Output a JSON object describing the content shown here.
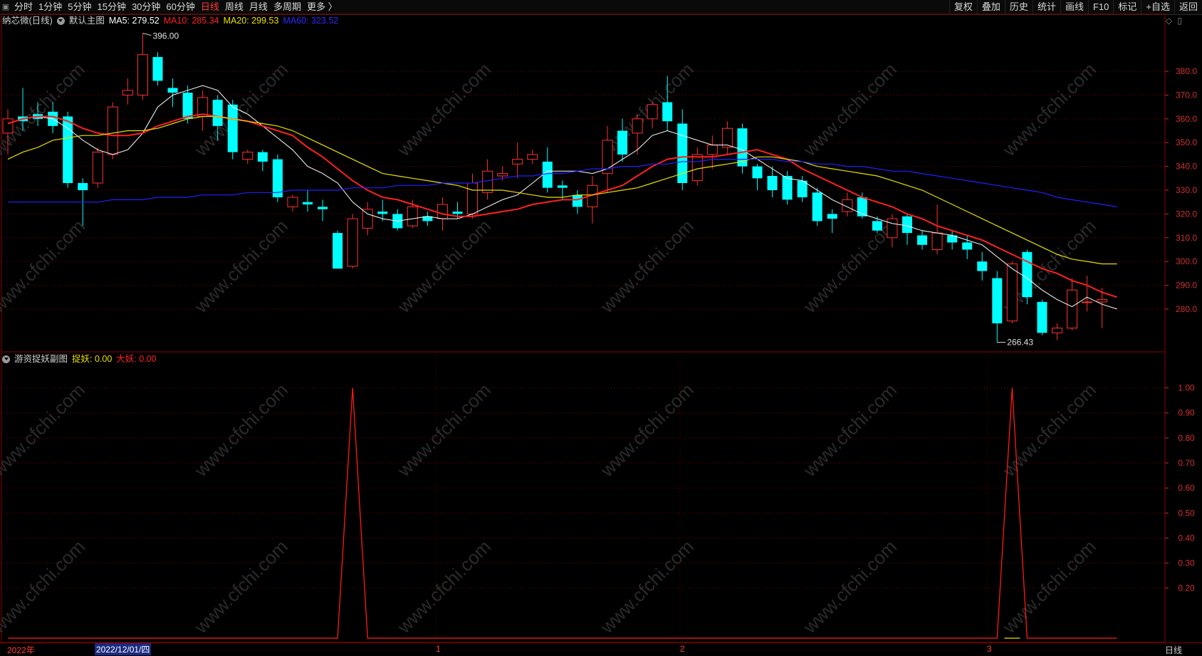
{
  "toolbar": {
    "window_icon": "▣",
    "periods": [
      "分时",
      "1分钟",
      "5分钟",
      "15分钟",
      "30分钟",
      "60分钟",
      "日线",
      "周线",
      "月线",
      "多周期",
      "更多 〉"
    ],
    "active_period": "日线",
    "right_buttons": [
      "复权",
      "叠加",
      "历史",
      "统计",
      "画线",
      "F10",
      "标记",
      "+自选",
      "返回"
    ]
  },
  "main_header": {
    "stock": "纳芯微(日线)",
    "template": "默认主图",
    "ma5": "MA5: 279.52",
    "ma10": "MA10: 285.34",
    "ma20": "MA20: 299.53",
    "ma60": "MA60: 323.52"
  },
  "sub_header": {
    "name": "游资捉妖副图",
    "zhuoyao": "捉妖: 0.00",
    "dayao": "大妖: 0.00"
  },
  "corner": {
    "diamond": "◇",
    "square": "▯"
  },
  "colors": {
    "up": "#ff3030",
    "down": "#00ffff",
    "ma5": "#ffffff",
    "ma10": "#ff2020",
    "ma20": "#e8e000",
    "ma60": "#2020ff",
    "grid": "#7a0000"
  },
  "annotations": {
    "high": "396.00",
    "low": "266.43"
  },
  "price_axis": [
    "380.0",
    "370.0",
    "360.0",
    "350.0",
    "340.0",
    "330.0",
    "320.0",
    "310.0",
    "300.0",
    "290.0",
    "280.0"
  ],
  "sub_axis": [
    "1.00",
    "0.90",
    "0.80",
    "0.70",
    "0.60",
    "0.50",
    "0.40",
    "0.30",
    "0.20"
  ],
  "date_bar": {
    "year_label": "2022年",
    "cursor_date": "2022/12/01/四",
    "months": [
      "1",
      "2",
      "3"
    ],
    "period_label": "日线"
  },
  "watermark": "www.cfchi.com",
  "chart_data": {
    "type": "candlestick",
    "y_range": [
      262,
      398
    ],
    "candles": [
      {
        "o": 354,
        "c": 360,
        "h": 364,
        "l": 345
      },
      {
        "o": 361,
        "c": 359,
        "h": 373,
        "l": 355
      },
      {
        "o": 362,
        "c": 360,
        "h": 367,
        "l": 357
      },
      {
        "o": 363,
        "c": 357,
        "h": 367,
        "l": 354
      },
      {
        "o": 361,
        "c": 333,
        "h": 363,
        "l": 331
      },
      {
        "o": 333,
        "c": 330,
        "h": 335,
        "l": 315
      },
      {
        "o": 333,
        "c": 346,
        "h": 348,
        "l": 331
      },
      {
        "o": 345,
        "c": 365,
        "h": 367,
        "l": 343
      },
      {
        "o": 370,
        "c": 372,
        "h": 377,
        "l": 366
      },
      {
        "o": 370,
        "c": 387,
        "h": 396,
        "l": 368
      },
      {
        "o": 386,
        "c": 376,
        "h": 388,
        "l": 374
      },
      {
        "o": 373,
        "c": 371,
        "h": 377,
        "l": 365
      },
      {
        "o": 371,
        "c": 360,
        "h": 374,
        "l": 358
      },
      {
        "o": 361,
        "c": 369,
        "h": 372,
        "l": 355
      },
      {
        "o": 368,
        "c": 357,
        "h": 370,
        "l": 351
      },
      {
        "o": 366,
        "c": 346,
        "h": 368,
        "l": 343
      },
      {
        "o": 343,
        "c": 346,
        "h": 347,
        "l": 341
      },
      {
        "o": 346,
        "c": 342,
        "h": 347,
        "l": 338
      },
      {
        "o": 343,
        "c": 327,
        "h": 345,
        "l": 325
      },
      {
        "o": 323,
        "c": 327,
        "h": 328,
        "l": 321
      },
      {
        "o": 325,
        "c": 324,
        "h": 330,
        "l": 321
      },
      {
        "o": 323,
        "c": 322,
        "h": 326,
        "l": 317
      },
      {
        "o": 312,
        "c": 297,
        "h": 313,
        "l": 297
      },
      {
        "o": 298,
        "c": 318,
        "h": 320,
        "l": 297
      },
      {
        "o": 314,
        "c": 322,
        "h": 325,
        "l": 311
      },
      {
        "o": 321,
        "c": 320,
        "h": 326,
        "l": 317
      },
      {
        "o": 320,
        "c": 314,
        "h": 322,
        "l": 313
      },
      {
        "o": 315,
        "c": 323,
        "h": 326,
        "l": 314
      },
      {
        "o": 319,
        "c": 317,
        "h": 321,
        "l": 315
      },
      {
        "o": 318,
        "c": 324,
        "h": 327,
        "l": 313
      },
      {
        "o": 321,
        "c": 320,
        "h": 325,
        "l": 318
      },
      {
        "o": 320,
        "c": 333,
        "h": 337,
        "l": 318
      },
      {
        "o": 329,
        "c": 338,
        "h": 343,
        "l": 326
      },
      {
        "o": 336,
        "c": 337,
        "h": 340,
        "l": 334
      },
      {
        "o": 341,
        "c": 343,
        "h": 350,
        "l": 335
      },
      {
        "o": 343,
        "c": 345,
        "h": 347,
        "l": 341
      },
      {
        "o": 342,
        "c": 331,
        "h": 348,
        "l": 329
      },
      {
        "o": 332,
        "c": 331,
        "h": 334,
        "l": 326
      },
      {
        "o": 328,
        "c": 323,
        "h": 330,
        "l": 320
      },
      {
        "o": 323,
        "c": 332,
        "h": 336,
        "l": 316
      },
      {
        "o": 337,
        "c": 351,
        "h": 357,
        "l": 329
      },
      {
        "o": 355,
        "c": 345,
        "h": 360,
        "l": 342
      },
      {
        "o": 354,
        "c": 360,
        "h": 362,
        "l": 345
      },
      {
        "o": 360,
        "c": 366,
        "h": 367,
        "l": 356
      },
      {
        "o": 367,
        "c": 359,
        "h": 378,
        "l": 355
      },
      {
        "o": 358,
        "c": 333,
        "h": 364,
        "l": 330
      },
      {
        "o": 334,
        "c": 345,
        "h": 348,
        "l": 332
      },
      {
        "o": 345,
        "c": 349,
        "h": 353,
        "l": 339
      },
      {
        "o": 348,
        "c": 356,
        "h": 359,
        "l": 345
      },
      {
        "o": 356,
        "c": 340,
        "h": 358,
        "l": 337
      },
      {
        "o": 340,
        "c": 335,
        "h": 341,
        "l": 330
      },
      {
        "o": 336,
        "c": 330,
        "h": 340,
        "l": 327
      },
      {
        "o": 336,
        "c": 326,
        "h": 338,
        "l": 324
      },
      {
        "o": 334,
        "c": 327,
        "h": 336,
        "l": 325
      },
      {
        "o": 329,
        "c": 317,
        "h": 331,
        "l": 315
      },
      {
        "o": 320,
        "c": 318,
        "h": 322,
        "l": 312
      },
      {
        "o": 321,
        "c": 326,
        "h": 329,
        "l": 319
      },
      {
        "o": 327,
        "c": 319,
        "h": 329,
        "l": 318
      },
      {
        "o": 317,
        "c": 313,
        "h": 319,
        "l": 312
      },
      {
        "o": 310,
        "c": 318,
        "h": 320,
        "l": 306
      },
      {
        "o": 319,
        "c": 312,
        "h": 320,
        "l": 307
      },
      {
        "o": 311,
        "c": 307,
        "h": 313,
        "l": 305
      },
      {
        "o": 305,
        "c": 312,
        "h": 324,
        "l": 303
      },
      {
        "o": 311,
        "c": 308,
        "h": 313,
        "l": 305
      },
      {
        "o": 308,
        "c": 305,
        "h": 311,
        "l": 301
      },
      {
        "o": 300,
        "c": 296,
        "h": 304,
        "l": 292
      },
      {
        "o": 293,
        "c": 274,
        "h": 296,
        "l": 266
      },
      {
        "o": 275,
        "c": 299,
        "h": 300,
        "l": 274
      },
      {
        "o": 304,
        "c": 285,
        "h": 305,
        "l": 282
      },
      {
        "o": 283,
        "c": 270,
        "h": 284,
        "l": 269
      },
      {
        "o": 270,
        "c": 272,
        "h": 274,
        "l": 267
      },
      {
        "o": 272,
        "c": 288,
        "h": 293,
        "l": 271
      },
      {
        "o": 283,
        "c": 283,
        "h": 294,
        "l": 279
      },
      {
        "o": 283,
        "c": 284,
        "h": 289,
        "l": 272
      }
    ],
    "ma_series": [
      {
        "name": "MA5",
        "values": [
          358,
          360,
          361,
          360,
          356,
          351,
          347,
          345,
          347,
          354,
          365,
          370,
          372,
          374,
          372,
          365,
          362,
          357,
          352,
          347,
          340,
          337,
          333,
          325,
          320,
          318,
          317,
          318,
          319,
          318,
          318,
          320,
          323,
          326,
          328,
          333,
          338,
          338,
          338,
          337,
          339,
          343,
          347,
          353,
          355,
          353,
          351,
          349,
          349,
          347,
          343,
          339,
          335,
          334,
          330,
          326,
          323,
          320,
          318,
          316,
          315,
          313,
          312,
          311,
          309,
          307,
          302,
          297,
          293,
          288,
          284,
          281,
          285,
          282,
          280
        ]
      },
      {
        "name": "MA10",
        "values": [
          358,
          360,
          361,
          361,
          359,
          356,
          354,
          353,
          353,
          354,
          357,
          359,
          361,
          362,
          361,
          360,
          359,
          357,
          355,
          353,
          348,
          344,
          339,
          334,
          330,
          327,
          326,
          324,
          322,
          320,
          319,
          319,
          320,
          321,
          322,
          324,
          325,
          326,
          326,
          328,
          330,
          332,
          336,
          340,
          343,
          344,
          344,
          344,
          345,
          346,
          347,
          345,
          343,
          339,
          336,
          333,
          330,
          327,
          325,
          323,
          320,
          318,
          315,
          313,
          311,
          309,
          306,
          303,
          300,
          297,
          295,
          292,
          290,
          287,
          285
        ]
      },
      {
        "name": "MA20",
        "values": [
          343,
          346,
          348,
          351,
          352,
          353,
          353,
          354,
          355,
          355,
          356,
          358,
          360,
          361,
          361,
          360,
          359,
          358,
          357,
          355,
          352,
          349,
          346,
          343,
          340,
          337,
          336,
          335,
          334,
          333,
          332,
          330,
          330,
          330,
          329,
          328,
          327,
          327,
          328,
          328,
          329,
          330,
          331,
          333,
          335,
          337,
          339,
          340,
          341,
          342,
          344,
          344,
          343,
          342,
          340,
          339,
          338,
          337,
          336,
          334,
          332,
          330,
          327,
          324,
          321,
          318,
          315,
          312,
          309,
          306,
          303,
          301,
          300,
          299,
          299
        ]
      },
      {
        "name": "MA60",
        "values": [
          325,
          325,
          325,
          325,
          325,
          325,
          325,
          326,
          326,
          326,
          327,
          327,
          327,
          328,
          328,
          328,
          329,
          329,
          329,
          330,
          330,
          330,
          330,
          331,
          331,
          331,
          332,
          332,
          332,
          333,
          333,
          333,
          334,
          335,
          336,
          336,
          337,
          337,
          338,
          339,
          339,
          340,
          340,
          341,
          341,
          342,
          342,
          343,
          343,
          343,
          343,
          343,
          342,
          342,
          341,
          341,
          340,
          340,
          339,
          338,
          338,
          337,
          336,
          335,
          334,
          333,
          332,
          331,
          330,
          329,
          327,
          326,
          325,
          324,
          323
        ]
      }
    ],
    "indicator": {
      "name": "游资捉妖副图",
      "y_range": [
        0,
        1.05
      ],
      "values": [
        0,
        0,
        0,
        0,
        0,
        0,
        0,
        0,
        0,
        0,
        0,
        0,
        0,
        0,
        0,
        0,
        0,
        0,
        0,
        0,
        0,
        0,
        0,
        1,
        0,
        0,
        0,
        0,
        0,
        0,
        0,
        0,
        0,
        0,
        0,
        0,
        0,
        0,
        0,
        0,
        0,
        0,
        0,
        0,
        0,
        0,
        0,
        0,
        0,
        0,
        0,
        0,
        0,
        0,
        0,
        0,
        0,
        0,
        0,
        0,
        0,
        0,
        0,
        0,
        0,
        0,
        0,
        1,
        0,
        0,
        0,
        0,
        0,
        0,
        0
      ]
    }
  }
}
